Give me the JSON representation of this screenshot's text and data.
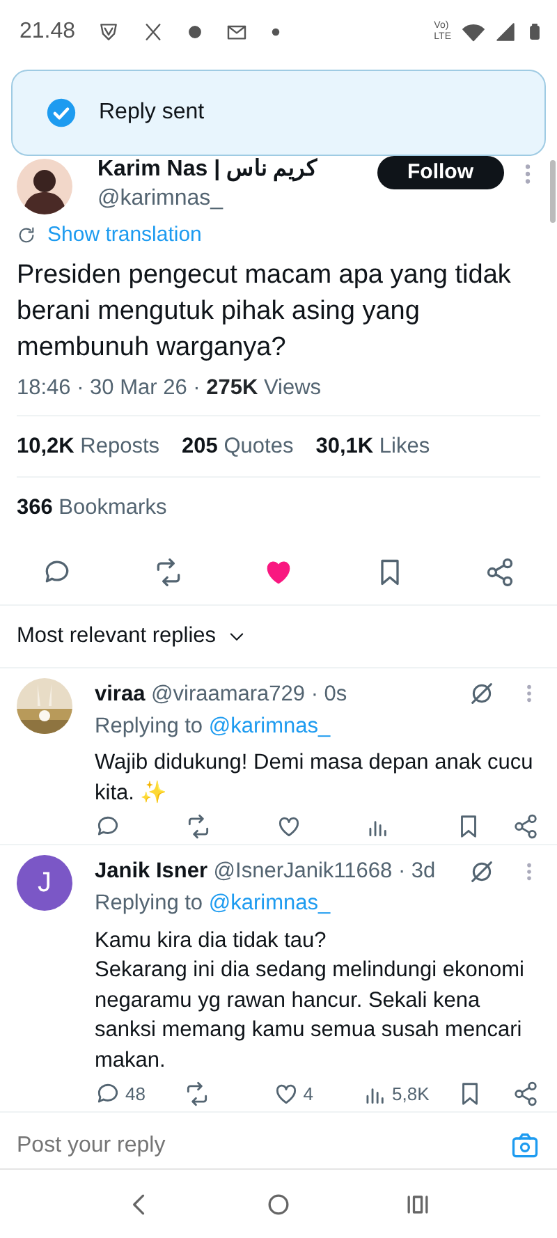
{
  "status_bar": {
    "time": "21.48",
    "network_top": "Vo)",
    "network_bottom": "LTE"
  },
  "toast": {
    "text": "Reply sent"
  },
  "tweet": {
    "author": "Karim Nas | كريم ناس",
    "handle": "@karimnas_",
    "follow_label": "Follow",
    "translation_label": "Show translation",
    "text": "Presiden pengecut macam apa yang tidak berani mengutuk pihak asing yang membunuh warganya?",
    "timestamp": "18:46 · 30 Mar 26 · ",
    "views_count": "275K",
    "views_label": "Views",
    "stats": [
      {
        "count": "10,2K",
        "label": "Reposts"
      },
      {
        "count": "205",
        "label": "Quotes"
      },
      {
        "count": "30,1K",
        "label": "Likes"
      }
    ],
    "bookmarks": {
      "count": "366",
      "label": "Bookmarks"
    },
    "actions": [
      {
        "kind": "reply",
        "active": false
      },
      {
        "kind": "repost",
        "active": false
      },
      {
        "kind": "like",
        "active": true
      },
      {
        "kind": "bookmark",
        "active": false
      },
      {
        "kind": "share",
        "active": false
      }
    ]
  },
  "sort_label": "Most relevant replies",
  "replies": [
    {
      "name": "viraa",
      "handle": "@viraamara729",
      "time": "· 0s",
      "replying_label": "Replying to",
      "replying_handle": "@karimnas_",
      "text": "Wajib didukung! Demi masa depan anak cucu kita. ✨"
    },
    {
      "avatar": {
        "kind": "letter",
        "letter": "J",
        "color": "#7b57c6"
      },
      "name": "Janik Isner",
      "handle": "@IsnerJanik11668",
      "time": "· 3d",
      "replying_label": "Replying to",
      "replying_handle": "@karimnas_",
      "text": "Kamu kira dia tidak tau?\nSekarang ini dia sedang melindungi ekonomi negaramu yg rawan hancur. Sekali kena sanksi memang kamu semua susah mencari makan.",
      "metrics": {
        "replies": "48",
        "likes": "4",
        "views": "5,8K"
      }
    }
  ],
  "compose": {
    "placeholder": "Post your reply"
  }
}
